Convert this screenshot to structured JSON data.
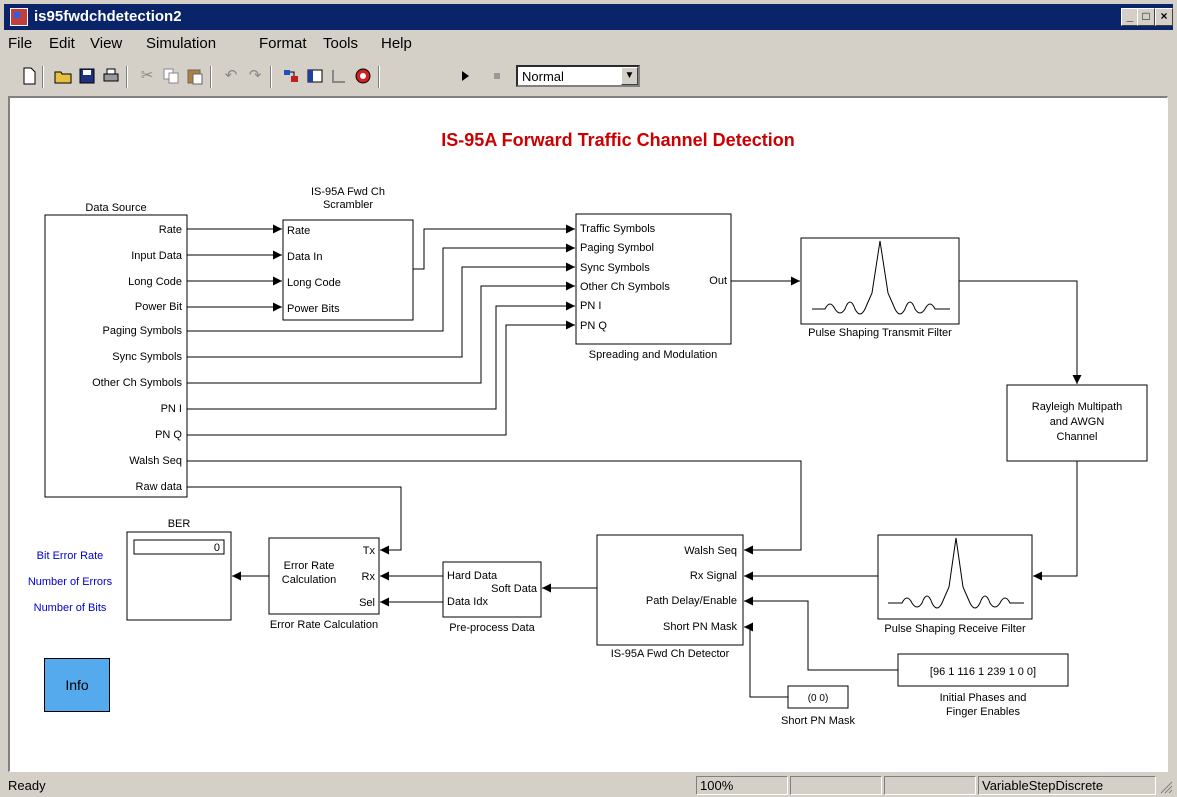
{
  "window": {
    "title": "is95fwdchdetection2",
    "controls": [
      "minimize",
      "maximize",
      "close"
    ]
  },
  "menu": [
    "File",
    "Edit",
    "View",
    "Simulation",
    "Format",
    "Tools",
    "Help"
  ],
  "toolbar": {
    "icons": [
      "new-file-icon",
      "open-folder-icon",
      "save-icon",
      "print-icon",
      "cut-icon",
      "copy-icon",
      "paste-icon",
      "undo-icon",
      "redo-icon",
      "library-browser-icon",
      "model-browser-icon",
      "toggle-icon",
      "debug-icon",
      "start-icon",
      "stop-icon"
    ],
    "sim_mode": "Normal"
  },
  "diagram": {
    "title": "IS-95A Forward Traffic Channel Detection",
    "accent_color": "#cc0000",
    "blue_text_color": "#0000cc",
    "data_source": {
      "name": "Data Source",
      "ports": [
        "Rate",
        "Input Data",
        "Long Code",
        "Power Bit",
        "Paging Symbols",
        "Sync Symbols",
        "Other Ch Symbols",
        "PN I",
        "PN Q",
        "Walsh Seq",
        "Raw data"
      ]
    },
    "scrambler": {
      "name_line1": "IS-95A Fwd Ch",
      "name_line2": "Scrambler",
      "ports": [
        "Rate",
        "Data In",
        "Long Code",
        "Power Bits"
      ]
    },
    "spreading": {
      "name": "Spreading and Modulation",
      "ports": [
        "Traffic Symbols",
        "Paging Symbol",
        "Sync Symbols",
        "Other Ch Symbols",
        "PN I",
        "PN Q"
      ],
      "out": "Out"
    },
    "tx_filter": {
      "name": "Pulse Shaping Transmit Filter"
    },
    "channel": {
      "line1": "Rayleigh Multipath",
      "line2": "and AWGN",
      "line3": "Channel"
    },
    "rx_filter": {
      "name": "Pulse Shaping Receive Filter"
    },
    "detector": {
      "name": "IS-95A Fwd Ch Detector",
      "ports": [
        "Walsh Seq",
        "Rx Signal",
        "Path Delay/Enable",
        "Short PN Mask"
      ]
    },
    "phases_const": {
      "value": "[96 1 116 1 239 1 0 0]",
      "label1": "Initial Phases and",
      "label2": "Finger Enables"
    },
    "pn_mask_const": {
      "value": "(0 0)",
      "label": "Short PN Mask"
    },
    "preprocess": {
      "name": "Pre-process Data",
      "in1": "Hard Data",
      "in2": "Data Idx",
      "out": "Soft Data"
    },
    "error_calc": {
      "name": "Error Rate Calculation",
      "line1": "Error Rate",
      "line2": "Calculation",
      "ports": [
        "Tx",
        "Rx",
        "Sel"
      ]
    },
    "ber": {
      "name": "BER",
      "value": "0"
    },
    "ber_labels": [
      "Bit Error Rate",
      "Number of Errors",
      "Number of Bits"
    ],
    "info": "Info"
  },
  "status": {
    "text": "Ready",
    "zoom": "100%",
    "solver": "VariableStepDiscrete"
  }
}
